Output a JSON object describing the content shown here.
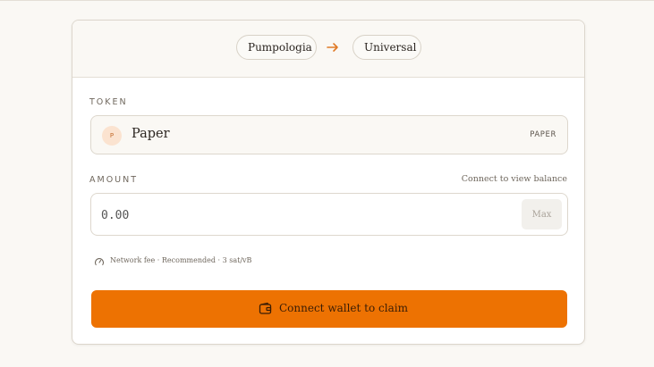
{
  "route": {
    "from_label": "Pumpologia",
    "to_label": "Universal",
    "arrow_icon": "arrow-right-icon"
  },
  "token": {
    "section_label": "TOKEN",
    "avatar_letter": "P",
    "name": "Paper",
    "ticker": "PAPER"
  },
  "amount": {
    "section_label": "AMOUNT",
    "balance_hint": "Connect to view balance",
    "placeholder": "0.00",
    "max_label": "Max"
  },
  "fee": {
    "icon": "gauge-icon",
    "text": "Network fee · Recommended · 3 sat/vB"
  },
  "action": {
    "icon": "wallet-icon",
    "label": "Connect wallet to claim"
  },
  "colors": {
    "accent": "#ed7202",
    "background": "#faf8f4",
    "card": "#ffffff"
  }
}
